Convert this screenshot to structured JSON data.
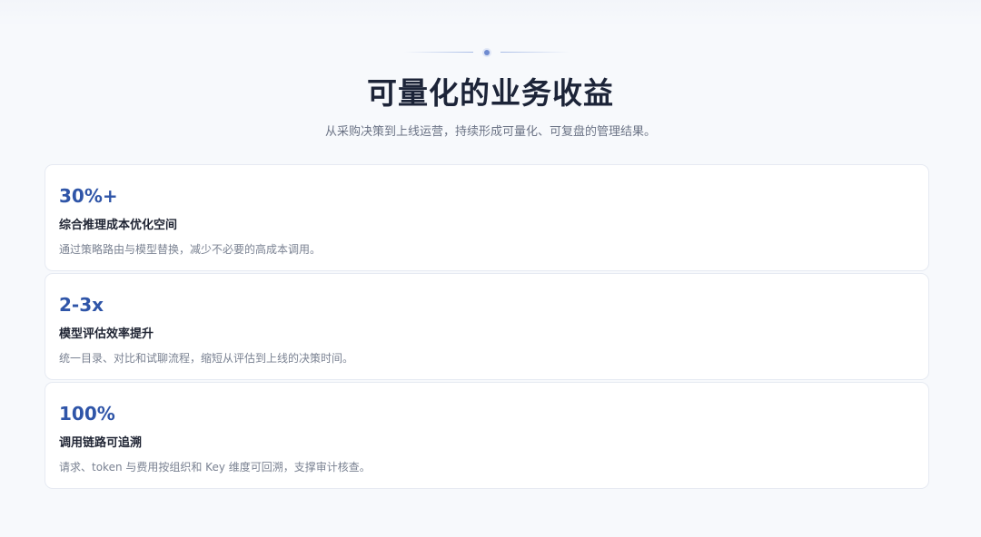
{
  "header": {
    "title": "可量化的业务收益",
    "subtitle": "从采购决策到上线运营，持续形成可量化、可复盘的管理结果。"
  },
  "cards": [
    {
      "metric": "30%+",
      "label": "综合推理成本优化空间",
      "description": "通过策略路由与模型替换，减少不必要的高成本调用。"
    },
    {
      "metric": "2-3x",
      "label": "模型评估效率提升",
      "description": "统一目录、对比和试聊流程，缩短从评估到上线的决策时间。"
    },
    {
      "metric": "100%",
      "label": "调用链路可追溯",
      "description": "请求、token 与费用按组织和 Key 维度可回溯，支撑审计核查。"
    }
  ],
  "colors": {
    "accent": "#2f55a8",
    "title": "#1c2438",
    "background": "#f7f9fc"
  }
}
